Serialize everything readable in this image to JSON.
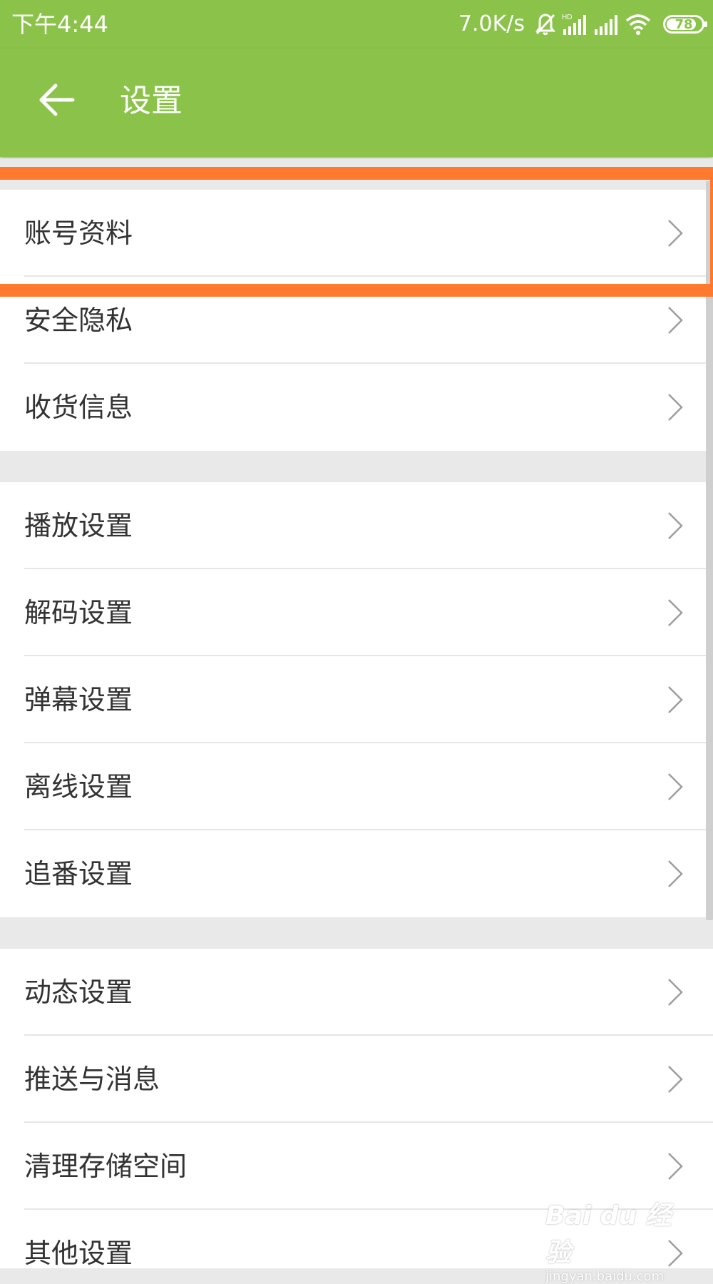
{
  "status_bar": {
    "time": "下午4:44",
    "network_speed": "7.0K/s",
    "battery_level": "78",
    "icons": [
      "mute-icon",
      "hd-signal-icon",
      "signal-icon",
      "wifi-icon",
      "battery-icon"
    ]
  },
  "app_bar": {
    "title": "设置",
    "back_icon": "arrow-left-icon",
    "background_color": "#8bc34a"
  },
  "groups": [
    {
      "items": [
        {
          "label": "账号资料"
        },
        {
          "label": "安全隐私"
        },
        {
          "label": "收货信息"
        }
      ]
    },
    {
      "items": [
        {
          "label": "播放设置"
        },
        {
          "label": "解码设置"
        },
        {
          "label": "弹幕设置"
        },
        {
          "label": "离线设置"
        },
        {
          "label": "追番设置"
        }
      ]
    },
    {
      "items": [
        {
          "label": "动态设置"
        },
        {
          "label": "推送与消息"
        },
        {
          "label": "清理存储空间"
        },
        {
          "label": "其他设置"
        }
      ]
    }
  ],
  "highlight_color": "#ff7a2e",
  "watermark": {
    "brand": "Bai du 经验",
    "url": "jingyan.baidu.com"
  }
}
